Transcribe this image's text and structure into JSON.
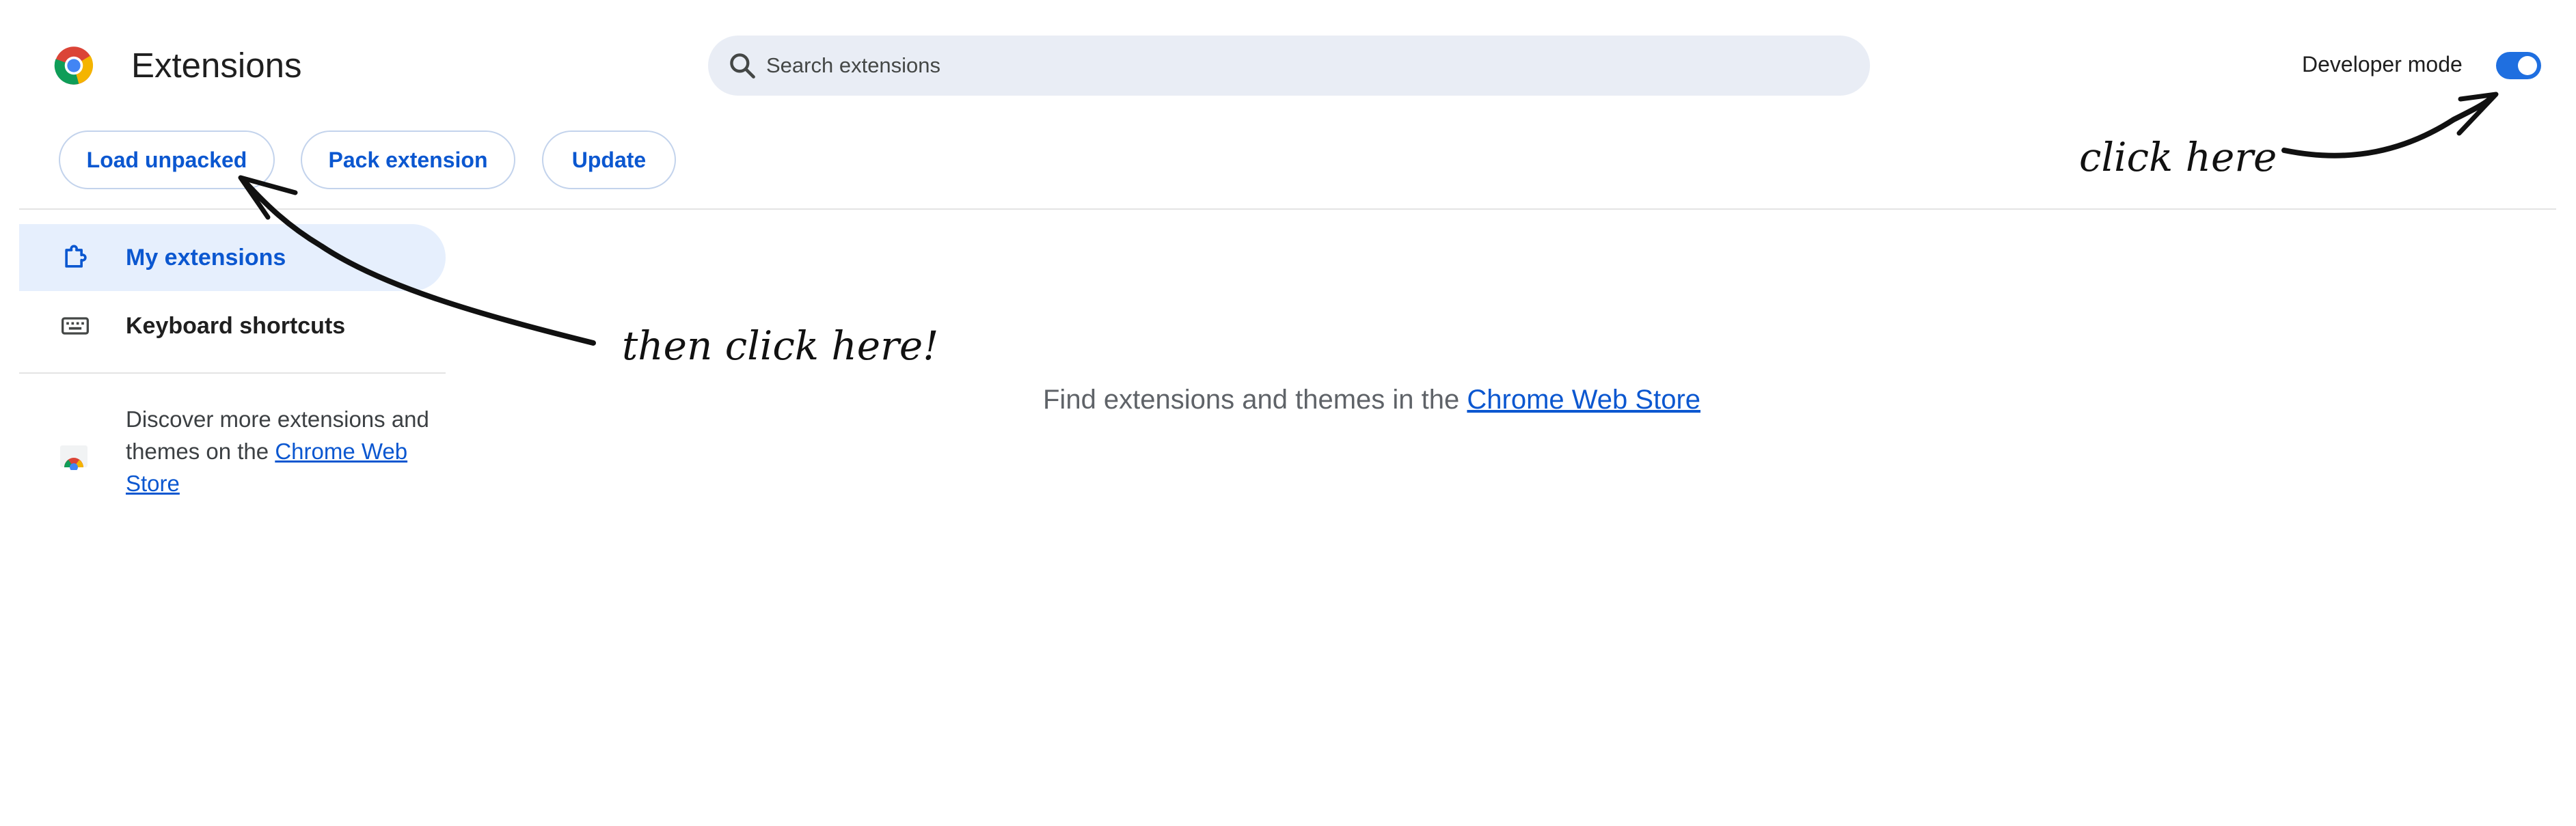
{
  "header": {
    "title": "Extensions",
    "search_placeholder": "Search extensions",
    "developer_mode_label": "Developer mode",
    "developer_mode_on": true
  },
  "toolbar": {
    "load_unpacked": "Load unpacked",
    "pack_extension": "Pack extension",
    "update": "Update"
  },
  "sidebar": {
    "items": [
      {
        "label": "My extensions",
        "icon": "puzzle-icon",
        "active": true
      },
      {
        "label": "Keyboard shortcuts",
        "icon": "keyboard-icon",
        "active": false
      }
    ],
    "discover_text": "Discover more extensions and themes on the",
    "discover_link": "Chrome Web Store"
  },
  "main": {
    "empty_text": "Find extensions and themes in the",
    "empty_link": "Chrome Web Store"
  },
  "annotations": {
    "first": "click here",
    "second": "then click here!"
  },
  "colors": {
    "accent": "#0b57d0",
    "toggle": "#1f6fe0",
    "active_bg": "#e6effd",
    "search_bg": "#e9edf5"
  }
}
